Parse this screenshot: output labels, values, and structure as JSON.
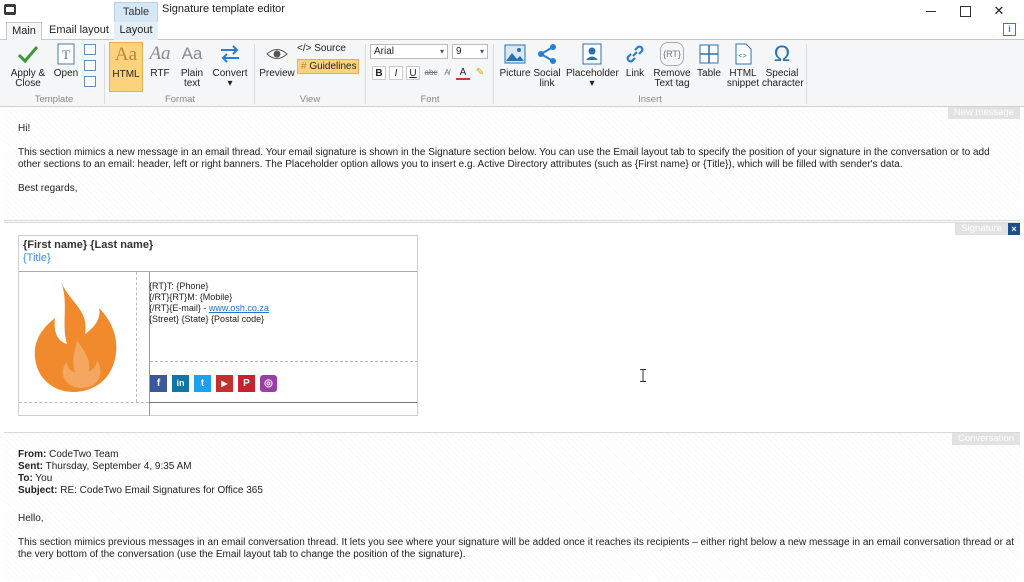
{
  "window": {
    "title": "Signature template editor",
    "context_tab_group": "Table"
  },
  "tabs": [
    "Main",
    "Email layout",
    "Layout"
  ],
  "ribbon": {
    "template": {
      "label": "Template",
      "apply_close_line1": "Apply &",
      "apply_close_line2": "Close",
      "open": "Open"
    },
    "format": {
      "label": "Format",
      "html": "HTML",
      "rtf": "RTF",
      "plain_line1": "Plain",
      "plain_line2": "text",
      "convert": "Convert",
      "aa_glyph": "Aa"
    },
    "view": {
      "label": "View",
      "preview": "Preview",
      "source": "</> Source",
      "guidelines": "Guidelines"
    },
    "font": {
      "label": "Font",
      "family": "Arial",
      "size": "9",
      "bold": "B",
      "italic": "I",
      "underline": "U",
      "strike": "abc"
    },
    "insert": {
      "label": "Insert",
      "picture": "Picture",
      "social_line1": "Social",
      "social_line2": "link",
      "placeholder": "Placeholder",
      "link": "Link",
      "remove_line1": "Remove",
      "remove_line2": "Text tag",
      "remove_icon_text": "{RT}",
      "table": "Table",
      "html_line1": "HTML",
      "html_line2": "snippet",
      "special_line1": "Special",
      "special_line2": "character"
    }
  },
  "new_message": {
    "label": "New message",
    "greeting": "Hi!",
    "body_line1": "This section mimics a new message in an email thread. Your email signature is shown in the Signature section below. You can use the Email layout tab to specify the position of your signature in the conversation or to add",
    "body_line2": "other sections to an email: header, left or right banners. The Placeholder option allows you to insert e.g. Active Directory attributes (such as {First name} or {Title}), which will be filled with sender's data.",
    "closing": "Best regards,"
  },
  "signature": {
    "label": "Signature",
    "close": "×",
    "name": "{First name} {Last name}",
    "title": "{Title}",
    "phone": "{RT}T: {Phone}",
    "mobile": "{/RT}{RT}M: {Mobile}",
    "email_prefix": "{/RT}{E-mail} - ",
    "website": "www.osh.co.za",
    "address": "{Street} {State} {Postal code}",
    "social": [
      {
        "name": "facebook",
        "glyph": "f",
        "color": "#3b5998"
      },
      {
        "name": "linkedin",
        "glyph": "in",
        "color": "#0e76a8"
      },
      {
        "name": "twitter",
        "glyph": "t",
        "color": "#1da1f2"
      },
      {
        "name": "youtube",
        "glyph": "▶",
        "color": "#c4302b"
      },
      {
        "name": "pinterest",
        "glyph": "P",
        "color": "#c8232c"
      },
      {
        "name": "instagram",
        "glyph": "◎",
        "color": "#9b3fa6"
      }
    ]
  },
  "conversation": {
    "label": "Conversation",
    "from_label": "From:",
    "from_value": " CodeTwo Team",
    "sent_label": "Sent:",
    "sent_value": " Thursday, September 4, 9:35 AM",
    "to_label": "To:",
    "to_value": " You",
    "subject_label": "Subject:",
    "subject_value": " RE: CodeTwo Email Signatures for Office 365",
    "hello": "Hello,",
    "body_line1": "This section mimics previous messages in an email conversation thread. It lets you see where your signature will be added once it reaches its recipients – either right below a new message in an email conversation thread or at",
    "body_line2": "the very bottom of the conversation (use the Email layout tab to change the position of the signature)."
  },
  "colors": {
    "accent": "#fcd37c",
    "link": "#2b6fcf",
    "flame_outer": "#f08a2c"
  }
}
